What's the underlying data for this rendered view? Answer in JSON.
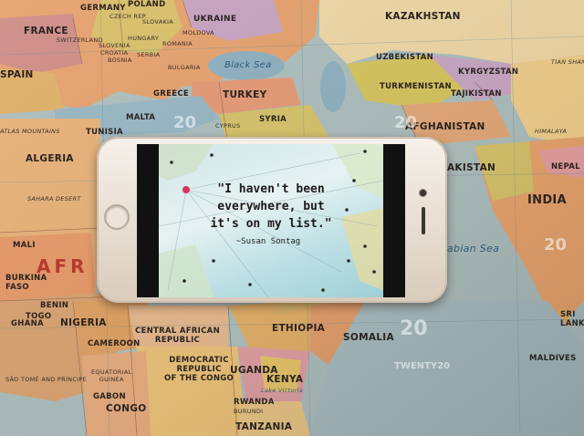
{
  "map": {
    "countries_large": [
      {
        "id": "kazakhstan",
        "label": "KAZAKHSTAN"
      },
      {
        "id": "turkey",
        "label": "TURKEY"
      },
      {
        "id": "afghanistan",
        "label": "AFGHANISTAN"
      },
      {
        "id": "india",
        "label": "INDIA"
      },
      {
        "id": "algeria",
        "label": "ALGERIA"
      },
      {
        "id": "nigeria",
        "label": "NIGERIA"
      },
      {
        "id": "ethiopia",
        "label": "ETHIOPIA"
      },
      {
        "id": "kenya",
        "label": "KENYA"
      },
      {
        "id": "uganda",
        "label": "UGANDA"
      },
      {
        "id": "somalia",
        "label": "SOMALIA"
      },
      {
        "id": "tanzania",
        "label": "TANZANIA"
      },
      {
        "id": "congo",
        "label": "CONGO"
      },
      {
        "id": "france",
        "label": "FRANCE"
      },
      {
        "id": "spain",
        "label": "SPAIN"
      },
      {
        "id": "ukraine",
        "label": "UKRAINE"
      }
    ],
    "countries_medium": [
      {
        "id": "germany",
        "label": "GERMANY"
      },
      {
        "id": "poland",
        "label": "POLAND"
      },
      {
        "id": "czech",
        "label": "CZECH REP."
      },
      {
        "id": "slovakia",
        "label": "SLOVAKIA"
      },
      {
        "id": "moldova",
        "label": "MOLDOVA"
      },
      {
        "id": "romania",
        "label": "ROMANIA"
      },
      {
        "id": "hungary",
        "label": "HUNGARY"
      },
      {
        "id": "switzerland",
        "label": "SWITZERLAND"
      },
      {
        "id": "slovenia",
        "label": "SLOVENIA"
      },
      {
        "id": "croatia",
        "label": "CROATIA"
      },
      {
        "id": "bosnia",
        "label": "BOSNIA"
      },
      {
        "id": "serbia",
        "label": "SERBIA"
      },
      {
        "id": "bulgaria",
        "label": "BULGARIA"
      },
      {
        "id": "greece",
        "label": "GREECE"
      },
      {
        "id": "malta",
        "label": "MALTA"
      },
      {
        "id": "tunisia",
        "label": "TUNISIA"
      },
      {
        "id": "cyprus",
        "label": "CYPRUS"
      },
      {
        "id": "syria",
        "label": "SYRIA"
      },
      {
        "id": "uzbekistan",
        "label": "UZBEKISTAN"
      },
      {
        "id": "kyrgyzstan",
        "label": "KYRGYZSTAN"
      },
      {
        "id": "turkmenistan",
        "label": "TURKMENISTAN"
      },
      {
        "id": "tajikistan",
        "label": "TAJIKISTAN"
      },
      {
        "id": "pakistan",
        "label": "AKISTAN"
      },
      {
        "id": "nepal",
        "label": "NEPAL"
      },
      {
        "id": "mali",
        "label": "MALI"
      },
      {
        "id": "burkina",
        "label": "BURKINA\nFASO"
      },
      {
        "id": "benin",
        "label": "BENIN"
      },
      {
        "id": "togo",
        "label": "TOGO"
      },
      {
        "id": "ghana",
        "label": "GHANA"
      },
      {
        "id": "car",
        "label": "CENTRAL AFRICAN\nREPUBLIC"
      },
      {
        "id": "cameroon",
        "label": "CAMEROON"
      },
      {
        "id": "eqguinea",
        "label": "EQUATORIAL\nGUINEA"
      },
      {
        "id": "gabon",
        "label": "GABON"
      },
      {
        "id": "drc",
        "label": "DEMOCRATIC\nREPUBLIC\nOF THE CONGO"
      },
      {
        "id": "rwanda",
        "label": "RWANDA"
      },
      {
        "id": "burundi",
        "label": "BURUNDI"
      },
      {
        "id": "maldives",
        "label": "MALDIVES"
      },
      {
        "id": "srilanka",
        "label": "SRI\nLANKA"
      },
      {
        "id": "saotome",
        "label": "SÃO TOMÉ AND PRÍNCIPE"
      }
    ],
    "regions": [
      {
        "id": "black-sea",
        "label": "Black Sea"
      },
      {
        "id": "arabian-sea",
        "label": "abian Sea"
      },
      {
        "id": "sahara",
        "label": "SAHARA DESERT"
      },
      {
        "id": "tian-shan",
        "label": "TIAN SHAN"
      },
      {
        "id": "himalayas",
        "label": "HIMALAYA"
      },
      {
        "id": "atlas",
        "label": "ATLAS MOUNTAINS"
      },
      {
        "id": "lake-victoria",
        "label": "Lake Victoria"
      },
      {
        "id": "africa",
        "label": "AFR"
      }
    ],
    "watermarks": [
      {
        "id": "wm1",
        "label": "20"
      },
      {
        "id": "wm2",
        "label": "20"
      },
      {
        "id": "wm3",
        "label": "20"
      },
      {
        "id": "wm4",
        "label": "TWENTY20"
      },
      {
        "id": "wm5",
        "label": "20"
      }
    ]
  },
  "phone": {
    "quote": "\"I haven't been\neverywhere, but\nit's on my list.\"",
    "author": "~Susan Sontag"
  }
}
